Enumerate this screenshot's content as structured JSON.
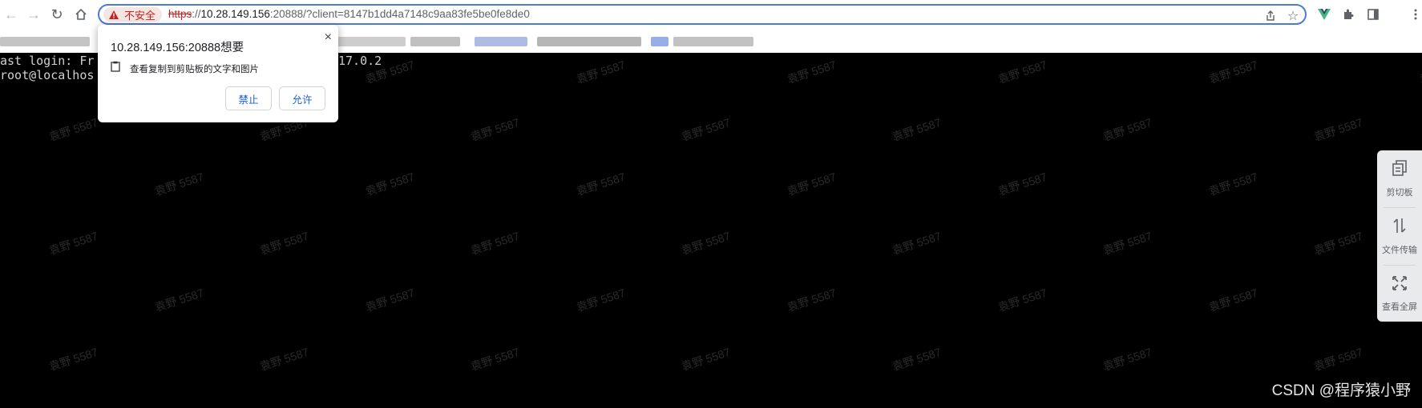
{
  "browser": {
    "security_label": "不安全",
    "url_scheme": "https",
    "url_sep": "://",
    "url_host": "10.28.149.156",
    "url_rest": ":20888/?client=8147b1dd4a7148c9aa83fe5be0fe8de0",
    "icons": [
      "back-icon",
      "forward-icon",
      "reload-icon",
      "home-icon",
      "share-icon",
      "star-icon",
      "vue-devtools-icon",
      "extensions-icon",
      "sidebar-icon",
      "menu-icon"
    ]
  },
  "terminal": {
    "line1_start": "ast login: Fr",
    "line1_end": "17.0.2",
    "line2_start": "root@localhos"
  },
  "popup": {
    "title": "10.28.149.156:20888想要",
    "permission": "查看复制到剪贴板的文字和图片",
    "block_label": "禁止",
    "allow_label": "允许",
    "close_symbol": "×"
  },
  "side_panel": {
    "items": [
      {
        "label": "剪切板",
        "icon": "clipboard-icon"
      },
      {
        "label": "文件传输",
        "icon": "transfer-icon"
      },
      {
        "label": "查看全屏",
        "icon": "fullscreen-icon"
      }
    ]
  },
  "watermark": "袁野 5587",
  "csdn": "CSDN @程序猿小野",
  "colors": {
    "accent": "#4a7bd6",
    "danger": "#c5221f",
    "popup_button_text": "#1a5fd0"
  }
}
